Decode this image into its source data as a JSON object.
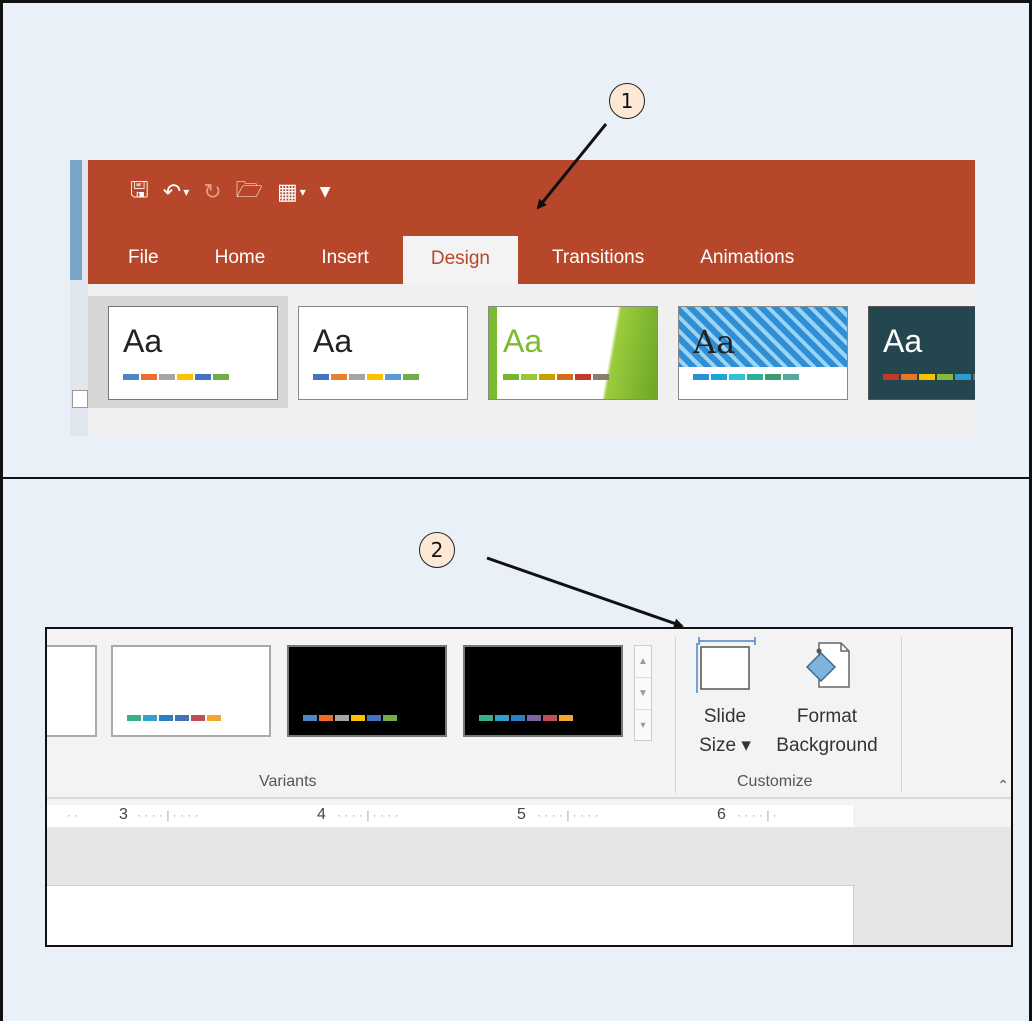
{
  "annotations": {
    "step1": "1",
    "step2": "2"
  },
  "quick_access": {
    "icons": [
      "save-icon",
      "undo-icon",
      "undo-dropdown-icon",
      "redo-icon",
      "open-folder-icon",
      "theme-colors-icon",
      "theme-dropdown-icon",
      "customize-qat-icon"
    ]
  },
  "ribbon_tabs": [
    {
      "label": "File"
    },
    {
      "label": "Home"
    },
    {
      "label": "Insert"
    },
    {
      "label": "Design",
      "active": true
    },
    {
      "label": "Transitions"
    },
    {
      "label": "Animations"
    }
  ],
  "themes": [
    {
      "label": "Aa",
      "colors": [
        "#4a86c8",
        "#ef6b2a",
        "#a5a5a5",
        "#ffc000",
        "#4472c4",
        "#70ad47"
      ]
    },
    {
      "label": "Aa",
      "colors": [
        "#4472c4",
        "#ed7d31",
        "#a5a5a5",
        "#ffc000",
        "#5b9bd5",
        "#70ad47"
      ]
    },
    {
      "label": "Aa",
      "colors": [
        "#76b72a",
        "#9bc53d",
        "#c8a000",
        "#d86a1e",
        "#c0392b",
        "#8b7d6b"
      ]
    },
    {
      "label": "Aa",
      "colors": [
        "#2b8fd6",
        "#1aa7d8",
        "#2fc4d0",
        "#28b29a",
        "#3d9d6a",
        "#5aa6a0"
      ]
    },
    {
      "label": "Aa",
      "colors": [
        "#c0392b",
        "#e87722",
        "#f4c300",
        "#84bd3a",
        "#2f9bd1",
        "#6f6f6f"
      ]
    }
  ],
  "variants": {
    "group_label": "Variants",
    "items": [
      {
        "dark": false,
        "colors": [
          "#3cae8c",
          "#33a0c8",
          "#2b7fc4",
          "#4473b8",
          "#c0504d",
          "#f0a830"
        ]
      },
      {
        "dark": true,
        "colors": [
          "#4a86c8",
          "#ef6b2a",
          "#a5a5a5",
          "#ffc000",
          "#4472c4",
          "#70ad47"
        ]
      },
      {
        "dark": true,
        "colors": [
          "#3cae8c",
          "#33a0c8",
          "#2b7fc4",
          "#8064a2",
          "#c0504d",
          "#f0a830"
        ]
      }
    ]
  },
  "customize": {
    "group_label": "Customize",
    "slide_size": {
      "line1": "Slide",
      "line2": "Size ▾"
    },
    "format_background": {
      "line1": "Format",
      "line2": "Background"
    }
  },
  "ruler": {
    "marks": [
      "3",
      "4",
      "5",
      "6"
    ]
  }
}
